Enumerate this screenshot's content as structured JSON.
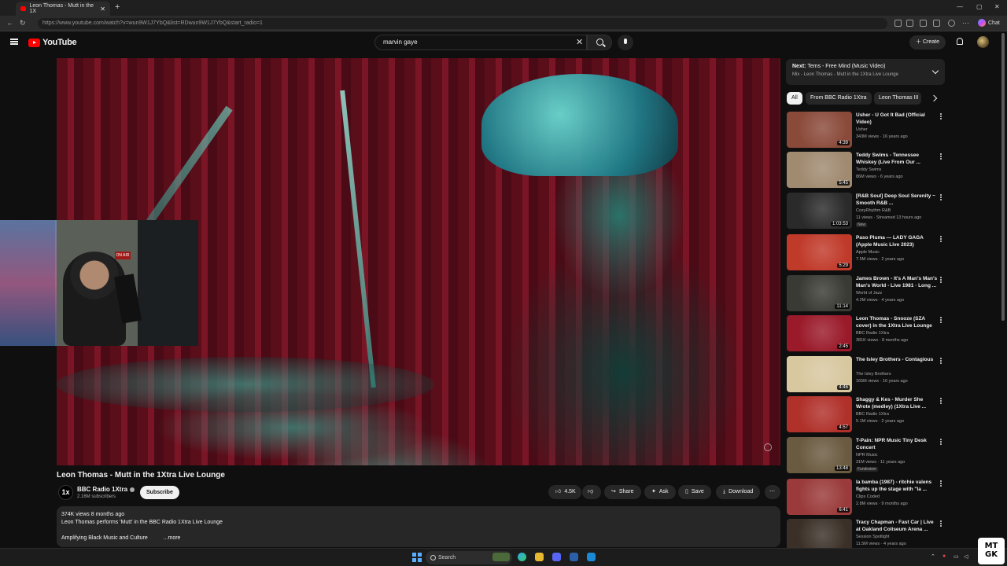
{
  "browser": {
    "tab_title": "Leon Thomas - Mutt in the 1X",
    "url": "https://www.youtube.com/watch?v=wun9W1J7YbQ&list=RDwun9W1J7YbQ&start_radio=1",
    "copilot_label": "Chat"
  },
  "header": {
    "logo_text": "YouTube",
    "search_value": "marvin gaye",
    "create_label": "Create"
  },
  "video": {
    "title": "Leon Thomas - Mutt in the 1Xtra Live Lounge",
    "channel_name": "BBC Radio 1Xtra",
    "channel_avatar_text": "1x",
    "subscribers": "2.16M subscribers",
    "subscribe_label": "Subscribe",
    "like_count": "4.5K",
    "share_label": "Share",
    "ask_label": "Ask",
    "save_label": "Save",
    "download_label": "Download",
    "webcam_sign": "ON AIR"
  },
  "description": {
    "meta": "374K views  8 months ago",
    "line1": "Leon Thomas performs 'Mutt' in the BBC Radio 1Xtra Live Lounge",
    "line2": "Amplifying Black Music and Culture",
    "more": "...more"
  },
  "up_next": {
    "label": "Next:",
    "title": "Tems - Free Mind (Music Video)",
    "subtitle": "Mix - Leon Thomas - Mutt in the 1Xtra Live Lounge"
  },
  "chips": [
    "All",
    "From BBC Radio 1Xtra",
    "Leon Thomas III"
  ],
  "recommendations": [
    {
      "title": "Usher - U Got It Bad (Official Video)",
      "channel": "Usher",
      "meta": "343M views · 16 years ago",
      "duration": "4:39",
      "badge": "",
      "color": "#8a4a3a"
    },
    {
      "title": "Teddy Swims - Tennessee Whiskey (Live From Our ...",
      "channel": "Teddy Swims",
      "meta": "86M views · 6 years ago",
      "duration": "5:45",
      "badge": "",
      "color": "#a08a70"
    },
    {
      "title": "[R&B Soul] Deep Soul Serenity ~ Smooth R&B ...",
      "channel": "CozyRhythm R&B",
      "meta": "11 views · Streamed 13 hours ago",
      "duration": "1:03:53",
      "badge": "New",
      "color": "#2a2a2a"
    },
    {
      "title": "Paso Pluma — LADY GAGA (Apple Music Live 2023)",
      "channel": "Apple Music",
      "meta": "7.5M views · 2 years ago",
      "duration": "5:29",
      "badge": "",
      "color": "#c03a2a"
    },
    {
      "title": "James Brown - It's A Man's Man's Man's World - Live 1981 · Long ...",
      "channel": "World of Jazz",
      "meta": "4.2M views · 4 years ago",
      "duration": "11:14",
      "badge": "",
      "color": "#3a3a34"
    },
    {
      "title": "Leon Thomas - Snooze (SZA cover) in the 1Xtra Live Lounge",
      "channel": "BBC Radio 1Xtra",
      "meta": "381K views · 8 months ago",
      "duration": "2:45",
      "badge": "",
      "color": "#9a1a2a"
    },
    {
      "title": "The Isley Brothers - Contagious",
      "channel": "The Isley Brothers",
      "meta": "165M views · 16 years ago",
      "duration": "4:46",
      "badge": "",
      "color": "#d8c8a0"
    },
    {
      "title": "Shaggy & Kes - Murder She Wrote (medley) (1Xtra Live ...",
      "channel": "BBC Radio 1Xtra",
      "meta": "5.1M views · 2 years ago",
      "duration": "4:57",
      "badge": "",
      "color": "#b0302a"
    },
    {
      "title": "T-Pain: NPR Music Tiny Desk Concert",
      "channel": "NPR Music",
      "meta": "31M views · 11 years ago",
      "duration": "13:48",
      "badge": "Fundraiser",
      "color": "#6a5a40"
    },
    {
      "title": "la bamba (1987) - ritchie valens fights up the stage with \"la ...",
      "channel": "Clips Coded",
      "meta": "2.8M views · 9 months ago",
      "duration": "6:41",
      "badge": "",
      "color": "#9a3a3a"
    },
    {
      "title": "Tracy Chapman - Fast Car | Live at Oakland Coliseum Arena ...",
      "channel": "Session Spotlight",
      "meta": "11.5M views · 4 years ago",
      "duration": "",
      "badge": "",
      "color": "#3a3028"
    }
  ],
  "taskbar": {
    "search_label": "Search",
    "brand_logo_text": "MTGK"
  },
  "colors": {
    "youtube_red": "#ff0000",
    "background": "#0f0f0f",
    "surface": "#272727"
  }
}
